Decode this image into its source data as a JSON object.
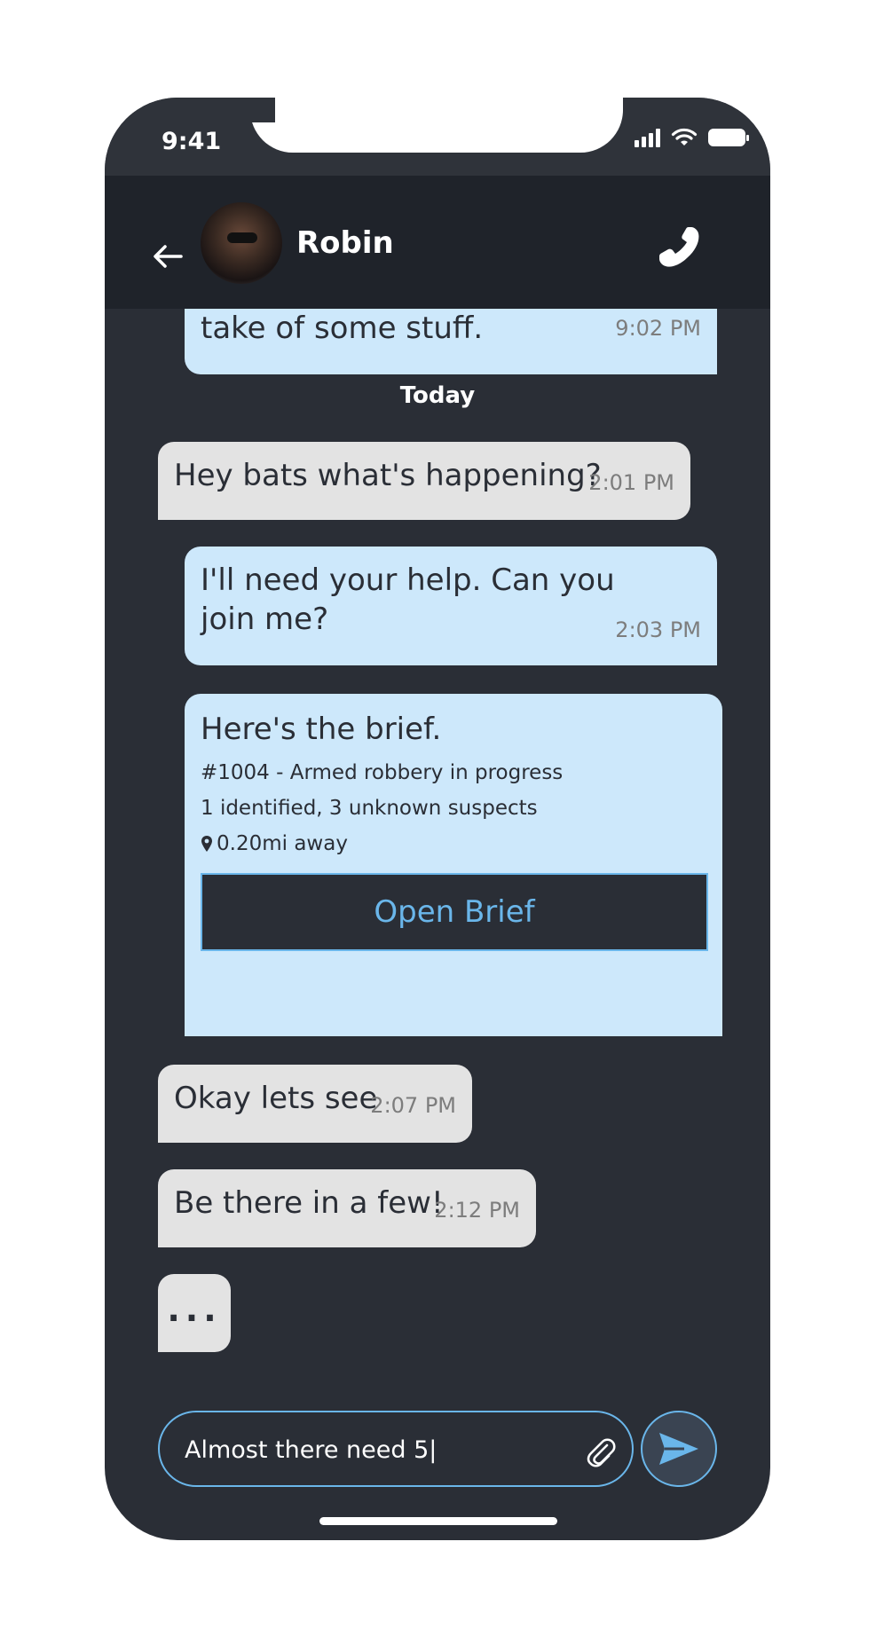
{
  "status_bar": {
    "time": "9:41"
  },
  "header": {
    "contact_name": "Robin"
  },
  "messages": {
    "previous": {
      "text": "take of some stuff.",
      "time": "9:02 PM"
    },
    "day_label": "Today",
    "m1": {
      "text": "Hey bats what's happening?",
      "time": "2:01 PM"
    },
    "m2": {
      "text_line1": "I'll need your help. Can you",
      "text_line2": "join me?",
      "time": "2:03 PM"
    },
    "brief": {
      "title": "Here's the brief.",
      "case": "#1004 - Armed robbery in progress",
      "suspects": "1 identified, 3 unknown suspects",
      "distance": "0.20mi away",
      "button_label": "Open Brief"
    },
    "m3": {
      "text": "Okay lets see",
      "time": "2:07 PM"
    },
    "m4": {
      "text": "Be there in a few!",
      "time": "2:12 PM"
    },
    "typing": "..."
  },
  "composer": {
    "value": "Almost there need 5|"
  },
  "colors": {
    "background": "#2a2e36",
    "header": "#1f232a",
    "outgoing_bubble": "#cde8fb",
    "incoming_bubble": "#e3e3e3",
    "accent": "#6ab6ea"
  }
}
